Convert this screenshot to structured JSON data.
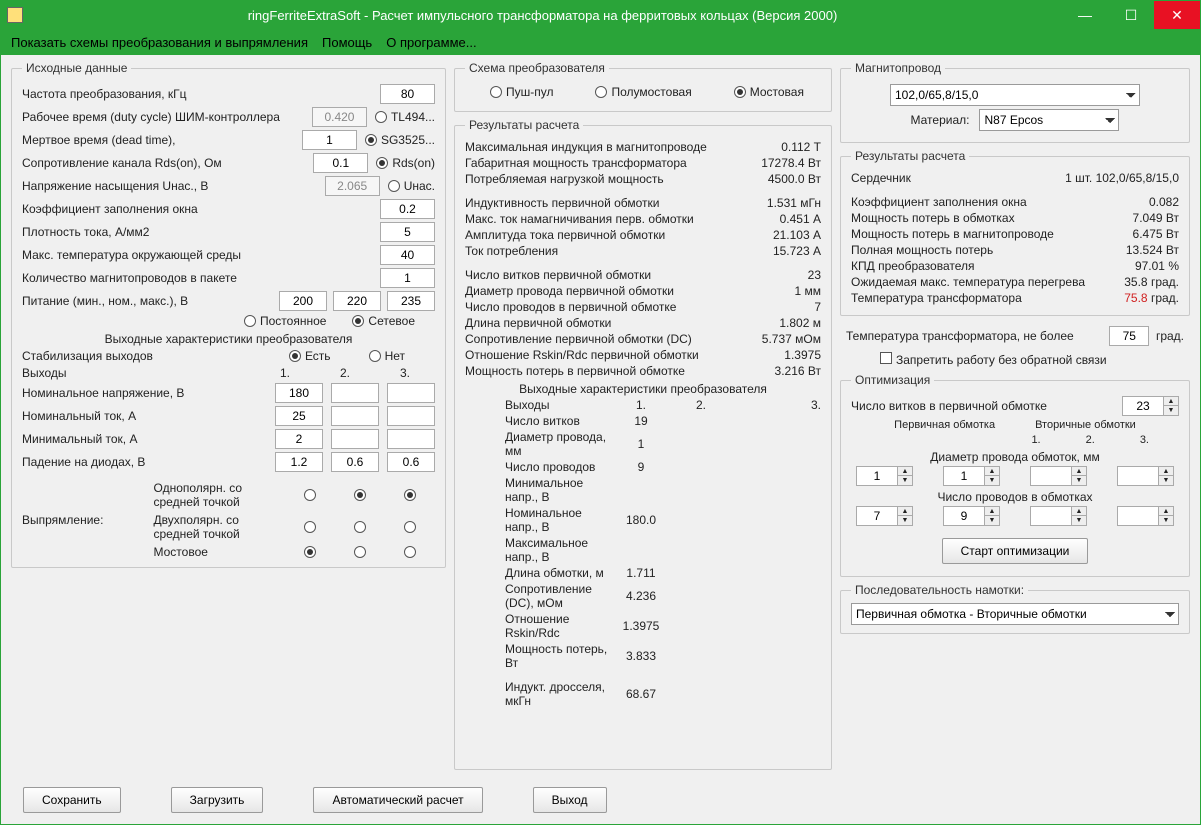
{
  "window": {
    "title": "ringFerriteExtraSoft - Расчет импульсного трансформатора на ферритовых кольцах (Версия 2000)"
  },
  "menu": {
    "schemes": "Показать схемы преобразования и выпрямления",
    "help": "Помощь",
    "about": "О программе..."
  },
  "col1": {
    "title": "Исходные данные",
    "freq": {
      "label": "Частота преобразования, кГц",
      "value": "80"
    },
    "duty": {
      "label": "Рабочее время (duty cycle) ШИМ-контроллера",
      "value": "0.420",
      "r1": "TL494..."
    },
    "dead": {
      "label": "Мертвое время (dead time),",
      "value": "1",
      "r1": "SG3525..."
    },
    "rds": {
      "label": "Сопротивление канала Rds(on), Ом",
      "value": "0.1",
      "r1": "Rds(on)"
    },
    "usat": {
      "label": "Напряжение насыщения Uнас., В",
      "value": "2.065",
      "r1": "Uнас."
    },
    "fill": {
      "label": "Коэффициент заполнения окна",
      "value": "0.2"
    },
    "dens": {
      "label": "Плотность тока, А/мм2",
      "value": "5"
    },
    "temp": {
      "label": "Макс. температура окружающей среды",
      "value": "40"
    },
    "cores": {
      "label": "Количество магнитопроводов  в пакете",
      "value": "1"
    },
    "power": {
      "label": "Питание (мин., ном., макс.), В",
      "v1": "200",
      "v2": "220",
      "v3": "235",
      "r1": "Постоянное",
      "r2": "Сетевое"
    },
    "outchar": {
      "title": "Выходные характеристики преобразователя",
      "stab": {
        "label": "Стабилизация выходов",
        "yes": "Есть",
        "no": "Нет"
      },
      "outputs": "Выходы",
      "c1": "1.",
      "c2": "2.",
      "c3": "3.",
      "vnom": {
        "label": "Номинальное напряжение, В",
        "v": "180"
      },
      "inom": {
        "label": "Номинальный ток, А",
        "v": "25"
      },
      "imin": {
        "label": "Минимальный ток, А",
        "v": "2"
      },
      "vdiode": {
        "label": "Падение на диодах, В",
        "v1": "1.2",
        "v2": "0.6",
        "v3": "0.6"
      },
      "rect": {
        "label": "Выпрямление:",
        "r1": "Однополярн. со средней точкой",
        "r2": "Двухполярн. со средней точкой",
        "r3": "Мостовое"
      }
    }
  },
  "col2": {
    "scheme": {
      "title": "Схема преобразователя",
      "o1": "Пуш-пул",
      "o2": "Полумостовая",
      "o3": "Мостовая"
    },
    "res": {
      "title": "Результаты расчета",
      "l1": {
        "k": "Максимальная индукция в магнитопроводе",
        "v": "0.112 Т"
      },
      "l2": {
        "k": "Габаритная мощность трансформатора",
        "v": "17278.4 Вт"
      },
      "l3": {
        "k": "Потребляемая нагрузкой мощность",
        "v": "4500.0 Вт"
      },
      "l4": {
        "k": "Индуктивность первичной обмотки",
        "v": "1.531 мГн"
      },
      "l5": {
        "k": "Макс. ток намагничивания перв. обмотки",
        "v": "0.451 А"
      },
      "l6": {
        "k": "Амплитуда тока первичной обмотки",
        "v": "21.103 А"
      },
      "l7": {
        "k": "Ток потребления",
        "v": "15.723 А"
      },
      "l8": {
        "k": "Число витков первичной обмотки",
        "v": "23"
      },
      "l9": {
        "k": "Диаметр провода первичной обмотки",
        "v": "1 мм"
      },
      "l10": {
        "k": "Число проводов в первичной обмотке",
        "v": "7"
      },
      "l11": {
        "k": "Длина  первичной обмотки",
        "v": "1.802 м"
      },
      "l12": {
        "k": "Сопротивление первичной обмотки (DC)",
        "v": "5.737 мОм"
      },
      "l13": {
        "k": "Отношение Rskin/Rdc первичной обмотки",
        "v": "1.3975"
      },
      "l14": {
        "k": "Мощность потерь в первичной обмотке",
        "v": "3.216 Вт"
      },
      "outtitle": "Выходные характеристики преобразователя",
      "oh": "Выходы",
      "c1": "1.",
      "c2": "2.",
      "c3": "3.",
      "o1": {
        "k": "Число витков",
        "v": "19"
      },
      "o2": {
        "k": "Диаметр провода, мм",
        "v": "1"
      },
      "o3": {
        "k": "Число проводов",
        "v": "9"
      },
      "o4": {
        "k": "Минимальное напр., В",
        "v": ""
      },
      "o5": {
        "k": "Номинальное напр., В",
        "v": "180.0"
      },
      "o6": {
        "k": "Максимальное напр., В",
        "v": ""
      },
      "o7": {
        "k": "Длина обмотки, м",
        "v": "1.711"
      },
      "o8": {
        "k": "Сопротивление (DC), мОм",
        "v": "4.236"
      },
      "o9": {
        "k": "Отношение Rskin/Rdc",
        "v": "1.3975"
      },
      "o10": {
        "k": "Мощность потерь, Вт",
        "v": "3.833"
      },
      "o11": {
        "k": "Индукт. дросселя, мкГн",
        "v": "68.67"
      }
    }
  },
  "col3": {
    "core": {
      "title": "Магнитопровод",
      "size": "102,0/65,8/15,0",
      "matlabel": "Материал:",
      "mat": "N87 Epcos"
    },
    "res": {
      "title": "Результаты расчета",
      "l1": {
        "k": "Сердечник",
        "v": "1 шт. 102,0/65,8/15,0"
      },
      "l2": {
        "k": "Коэффициент заполнения окна",
        "v": "0.082"
      },
      "l3": {
        "k": "Мощность потерь в обмотках",
        "v": "7.049 Вт"
      },
      "l4": {
        "k": "Мощность потерь в магнитопроводе",
        "v": "6.475 Вт"
      },
      "l5": {
        "k": "Полная мощность потерь",
        "v": "13.524 Вт"
      },
      "l6": {
        "k": "КПД преобразователя",
        "v": "97.01 %"
      },
      "l7": {
        "k": "Ожидаемая макс. температура перегрева",
        "v": "35.8 град."
      },
      "l8": {
        "k": "Температура трансформатора",
        "v": "75.8",
        "u": "град."
      }
    },
    "limit": {
      "label": "Температура трансформатора, не более",
      "value": "75",
      "unit": "град."
    },
    "nofb": "Запретить работу без обратной связи",
    "opt": {
      "title": "Оптимизация",
      "turns": {
        "label": "Число витков в первичной обмотке",
        "value": "23"
      },
      "prim": "Первичная обмотка",
      "sec": "Вторичные обмотки",
      "c1": "1.",
      "c2": "2.",
      "c3": "3.",
      "diam": "Диаметр провода обмоток, мм",
      "d1": "1",
      "d2": "1",
      "wires": "Число проводов в обмотках",
      "w1": "7",
      "w2": "9",
      "start": "Старт оптимизации",
      "seqlabel": "Последовательность намотки:",
      "seq": "Первичная обмотка - Вторичные обмотки"
    }
  },
  "footer": {
    "save": "Сохранить",
    "load": "Загрузить",
    "auto": "Автоматический расчет",
    "exit": "Выход"
  }
}
